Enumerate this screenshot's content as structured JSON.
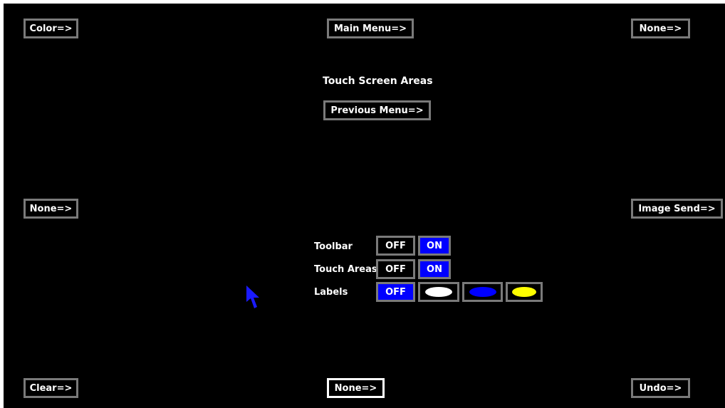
{
  "colors": {
    "background": "#000000",
    "text": "#ffffff",
    "button_border": "#7a7a7a",
    "active": "#0000ff",
    "swatch_white": "#ffffff",
    "swatch_blue": "#0000ff",
    "swatch_yellow": "#ffff00",
    "cursor": "#1a1aff"
  },
  "corners": {
    "top_left": "Color=>",
    "top_center": "Main Menu=>",
    "top_right": "None=>",
    "middle_left": "None=>",
    "middle_right": "Image Send=>",
    "bottom_left": "Clear=>",
    "bottom_center": "None=>",
    "bottom_right": "Undo=>"
  },
  "menu": {
    "title": "Touch Screen Areas",
    "previous": "Previous Menu=>"
  },
  "settings": {
    "toolbar": {
      "label": "Toolbar",
      "off": "OFF",
      "on": "ON",
      "selected": "ON"
    },
    "touch_areas": {
      "label": "Touch Areas",
      "off": "OFF",
      "on": "ON",
      "selected": "ON"
    },
    "labels": {
      "label": "Labels",
      "off": "OFF",
      "selected": "OFF",
      "swatches": [
        "white-ellipse-icon",
        "blue-ellipse-icon",
        "yellow-ellipse-icon"
      ]
    }
  },
  "cursor_icon": "arrow-pointer-icon"
}
